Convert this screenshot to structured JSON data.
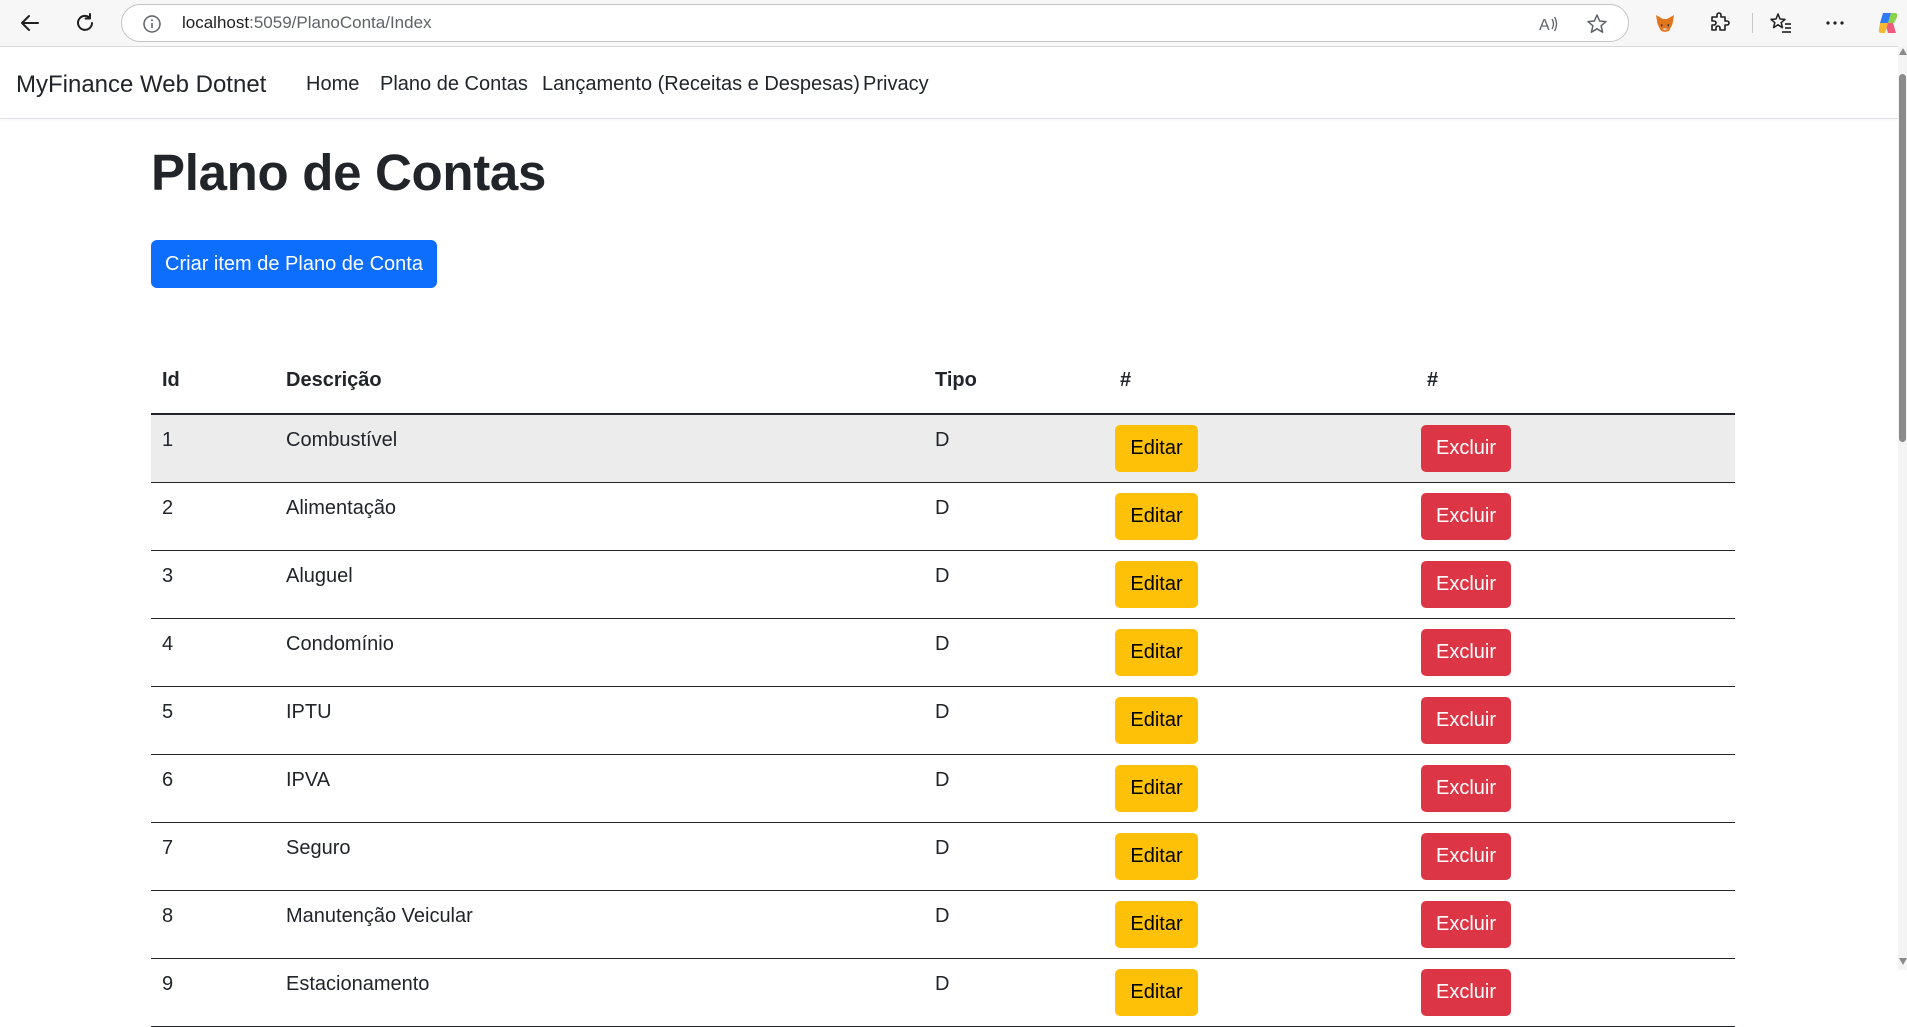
{
  "browser": {
    "url_host": "localhost",
    "url_path": ":5059/PlanoConta/Index",
    "icons": [
      "back-arrow-icon",
      "refresh-icon",
      "info-icon",
      "read-aloud-icon",
      "star-icon",
      "fox-extension-icon",
      "puzzle-extension-icon",
      "favorites-icon",
      "more-icon",
      "copilot-icon"
    ]
  },
  "navbar": {
    "brand": "MyFinance Web Dotnet",
    "links": [
      "Home",
      "Plano de Contas",
      "Lançamento (Receitas e Despesas)",
      "Privacy"
    ]
  },
  "main": {
    "title": "Plano de Contas",
    "create_button": "Criar item de Plano de Conta"
  },
  "table": {
    "headers": [
      "Id",
      "Descrição",
      "Tipo",
      "#",
      "#"
    ],
    "rows": [
      {
        "id": "1",
        "descricao": "Combustível",
        "tipo": "D",
        "edit": "Editar",
        "delete": "Excluir"
      },
      {
        "id": "2",
        "descricao": "Alimentação",
        "tipo": "D",
        "edit": "Editar",
        "delete": "Excluir"
      },
      {
        "id": "3",
        "descricao": "Aluguel",
        "tipo": "D",
        "edit": "Editar",
        "delete": "Excluir"
      },
      {
        "id": "4",
        "descricao": "Condomínio",
        "tipo": "D",
        "edit": "Editar",
        "delete": "Excluir"
      },
      {
        "id": "5",
        "descricao": "IPTU",
        "tipo": "D",
        "edit": "Editar",
        "delete": "Excluir"
      },
      {
        "id": "6",
        "descricao": "IPVA",
        "tipo": "D",
        "edit": "Editar",
        "delete": "Excluir"
      },
      {
        "id": "7",
        "descricao": "Seguro",
        "tipo": "D",
        "edit": "Editar",
        "delete": "Excluir"
      },
      {
        "id": "8",
        "descricao": "Manutenção Veicular",
        "tipo": "D",
        "edit": "Editar",
        "delete": "Excluir"
      },
      {
        "id": "9",
        "descricao": "Estacionamento",
        "tipo": "D",
        "edit": "Editar",
        "delete": "Excluir"
      }
    ]
  },
  "colors": {
    "primary": "#0d6efd",
    "warning": "#ffc107",
    "danger": "#dc3545",
    "text": "#212529",
    "hover_row": "#ececec"
  }
}
